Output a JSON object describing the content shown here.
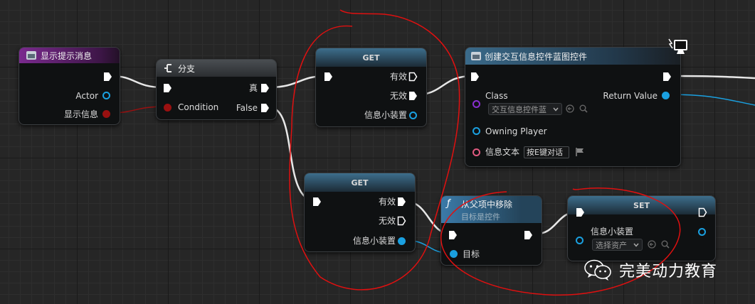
{
  "nodes": {
    "event": {
      "title": "显示提示消息",
      "actor": "Actor",
      "info": "显示信息"
    },
    "branch": {
      "title": "分支",
      "condition": "Condition",
      "true_label": "真",
      "false_label": "False"
    },
    "get_top": {
      "title": "GET",
      "valid": "有效",
      "invalid": "无效",
      "output": "信息小装置"
    },
    "get_bottom": {
      "title": "GET",
      "valid": "有效",
      "invalid": "无效",
      "output": "信息小装置"
    },
    "create": {
      "title": "创建交互信息控件蓝图控件",
      "class_label": "Class",
      "class_value": "交互信息控件蓝",
      "owning_player": "Owning Player",
      "text_label": "信息文本",
      "text_value": "按E键对话",
      "return_value": "Return Value"
    },
    "remove": {
      "title": "从父项中移除",
      "subtitle": "目标是控件",
      "target": "目标"
    },
    "set": {
      "title": "SET",
      "var_label": "信息小装置",
      "var_value": "选择资产"
    }
  },
  "watermark": {
    "text": "完美动力教育"
  },
  "colors": {
    "exec": "#ffffff",
    "object_pin": "#1aa0e0",
    "string_pin": "#e05a80",
    "bool_pin": "#9a1010",
    "class_pin": "#8a2ed0",
    "annotation": "#e01010"
  }
}
